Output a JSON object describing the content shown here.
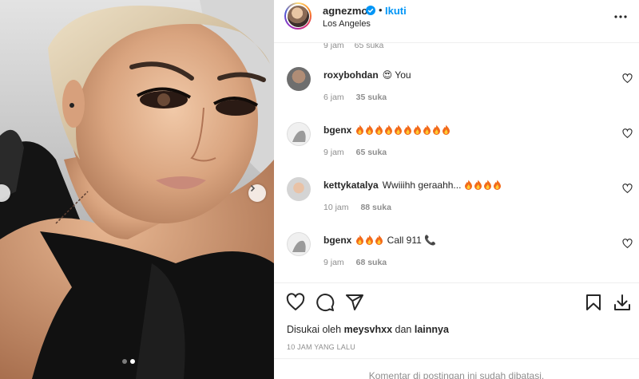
{
  "post": {
    "username": "agnezmo",
    "separator": "•",
    "follow_label": "Ikuti",
    "location": "Los Angeles"
  },
  "colors": {
    "accent": "#0095f6",
    "text": "#262626",
    "muted": "#8e8e8e",
    "divider": "#efefef"
  },
  "carousel": {
    "total_slides": 2,
    "active_index": 1
  },
  "cutoff_comment": {
    "time": "9 jam",
    "likes": "65 suka"
  },
  "comments": [
    {
      "username": "roxybohdan",
      "emoji": "😍",
      "text": " You",
      "time": "6 jam",
      "likes": "35 suka",
      "flames": 0
    },
    {
      "username": "bgenx",
      "emoji": "",
      "text": "",
      "time": "9 jam",
      "likes": "65 suka",
      "flames": 10
    },
    {
      "username": "kettykatalya",
      "emoji": "",
      "text": "Wwiiihh geraahh... ",
      "time": "10 jam",
      "likes": "88 suka",
      "flames": 4
    },
    {
      "username": "bgenx",
      "emoji": "",
      "text": " Call 911 📞",
      "time": "9 jam",
      "likes": "68 suka",
      "flames": 3
    }
  ],
  "actions": {
    "icons": [
      "heart-icon",
      "comment-icon",
      "share-icon",
      "bookmark-icon",
      "download-icon"
    ]
  },
  "liked_by": {
    "prefix": "Disukai oleh ",
    "user": "meysvhxx",
    "middle": " dan ",
    "others": "lainnya"
  },
  "timestamp": "10 JAM YANG LALU",
  "comments_disabled": "Komentar di postingan ini sudah dibatasi."
}
